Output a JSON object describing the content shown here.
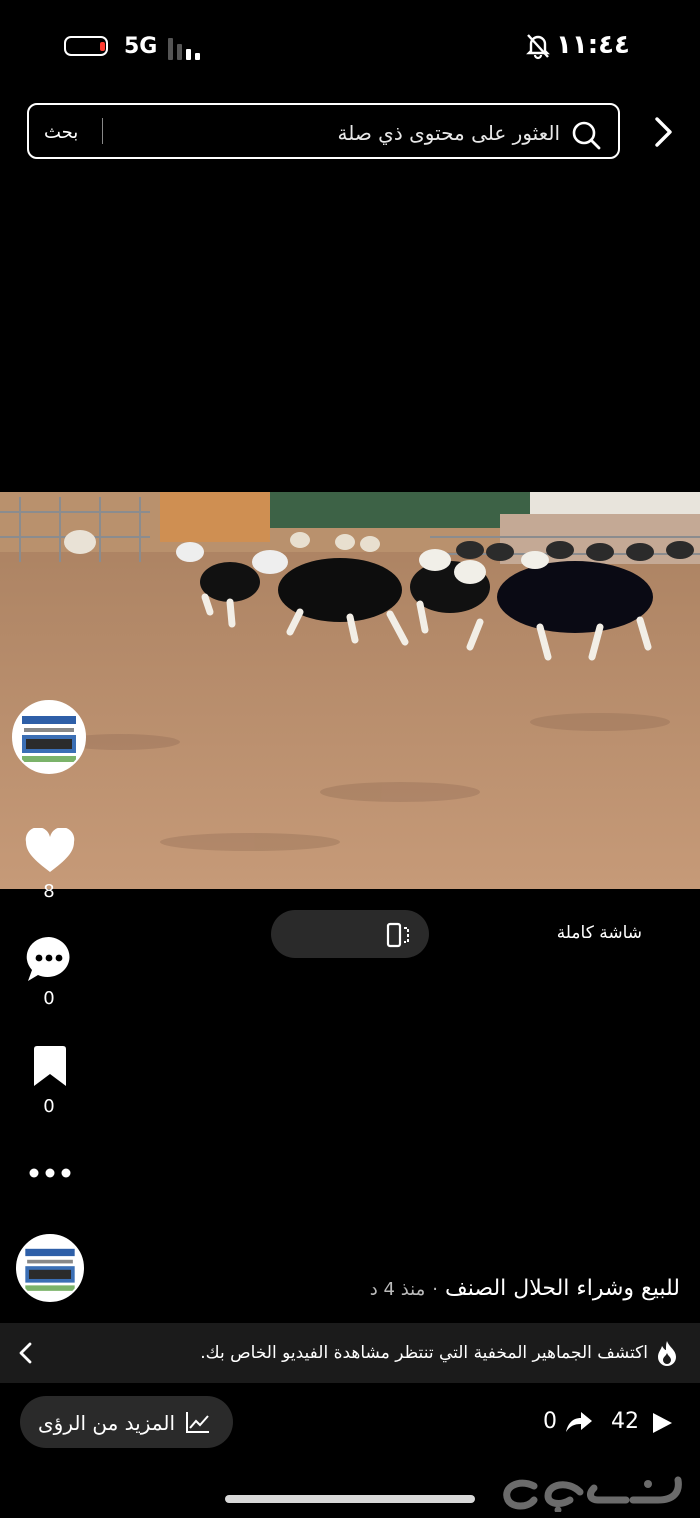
{
  "status_bar": {
    "network": "5G",
    "time": "١١:٤٤",
    "battery_level": 0.15
  },
  "search": {
    "placeholder": "العثور على محتوى ذي صلة",
    "button": "بحث"
  },
  "actions": {
    "likes": "8",
    "comments": "0",
    "saves": "0"
  },
  "fullscreen": {
    "label": "شاشة كاملة"
  },
  "post": {
    "caption": "للبيع وشراء الحلال الصنف",
    "time_ago": "منذ 4 د",
    "separator": "·"
  },
  "banner": {
    "text": "اكتشف الجماهير المخفية التي تنتظر مشاهدة الفيديو الخاص بك."
  },
  "insights": {
    "label": "المزيد من الرؤى"
  },
  "stats": {
    "views": "42",
    "shares": "0"
  },
  "watermark": "حراج",
  "colors": {
    "battery_low": "#ff3b30",
    "banner_bg": "#1b1b1b",
    "pill_bg": "#2a2a2a"
  }
}
